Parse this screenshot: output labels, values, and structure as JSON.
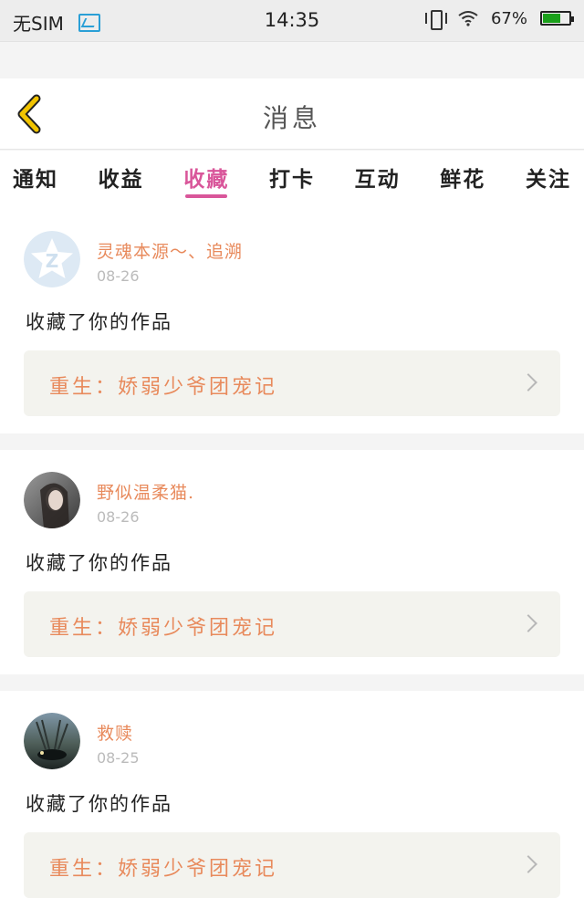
{
  "status_bar": {
    "carrier": "无SIM",
    "time": "14:35",
    "battery_pct": "67%",
    "battery_level": 0.67,
    "icons": [
      "image-icon",
      "vibrate-icon",
      "wifi-icon",
      "battery-icon"
    ]
  },
  "header": {
    "title": "消息",
    "back_icon": "chevron-left-icon",
    "back_color": "#f2c400"
  },
  "tabs": [
    {
      "label": "通知",
      "active": false
    },
    {
      "label": "收益",
      "active": false
    },
    {
      "label": "收藏",
      "active": true
    },
    {
      "label": "打卡",
      "active": false
    },
    {
      "label": "互动",
      "active": false
    },
    {
      "label": "鲜花",
      "active": false
    },
    {
      "label": "关注",
      "active": false
    }
  ],
  "colors": {
    "accent": "#d9569a",
    "username": "#e88a5c",
    "card_bg": "#f3f3ee"
  },
  "messages": [
    {
      "username": "灵魂本源～、追溯",
      "date": "08-26",
      "action": "收藏了你的作品",
      "work_title": "重生：娇弱少爷团宠记",
      "avatar": "qq-default-avatar-icon"
    },
    {
      "username": "野似温柔猫.",
      "date": "08-26",
      "action": "收藏了你的作品",
      "work_title": "重生：娇弱少爷团宠记",
      "avatar": "user-photo-avatar"
    },
    {
      "username": "救赎",
      "date": "08-25",
      "action": "收藏了你的作品",
      "work_title": "重生：娇弱少爷团宠记",
      "avatar": "user-photo-avatar"
    }
  ]
}
